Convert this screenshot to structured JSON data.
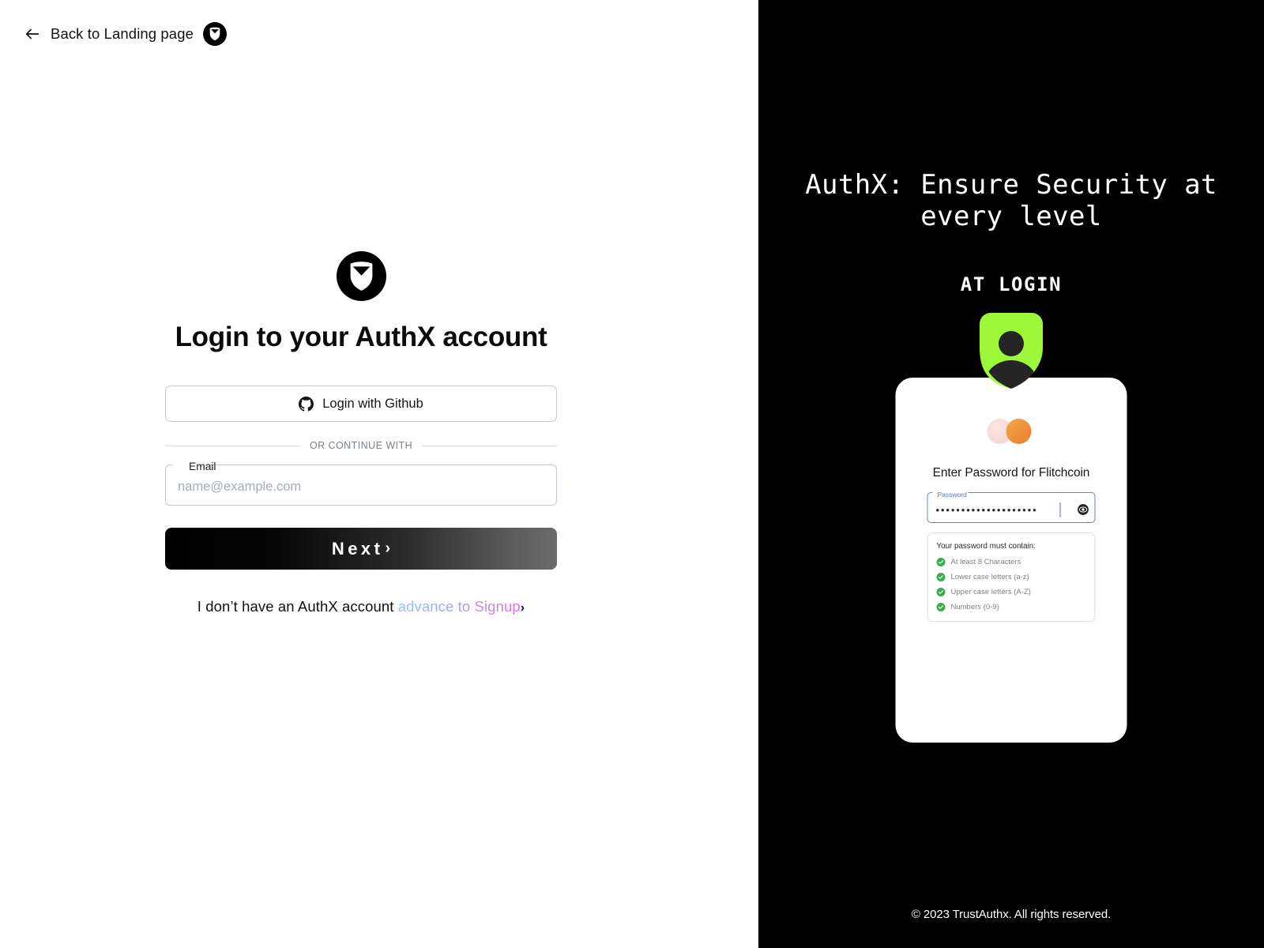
{
  "left": {
    "back_link": {
      "label": "Back to Landing page",
      "arrow_icon": "arrow-left-icon",
      "brand_icon": "authx-shield-badge-icon"
    },
    "logo_icon": "authx-shield-logo-icon",
    "title": "Login to your AuthX account",
    "github_button": {
      "label": "Login with Github",
      "icon": "github-icon"
    },
    "divider_text": "OR CONTINUE WITH",
    "email_field": {
      "label": "Email",
      "placeholder": "name@example.com",
      "value": ""
    },
    "next_button": {
      "label": "Next",
      "chevron": "›"
    },
    "signup": {
      "prefix": "I don’t have an AuthX account",
      "link": "advance to Signup",
      "chevron": "›"
    }
  },
  "right": {
    "promo_title": "AuthX: Ensure Security at every level",
    "promo_subtitle": "AT LOGIN",
    "shield_icon": "user-shield-icon",
    "card": {
      "brand_icon": "mastercard-logo-icon",
      "heading": "Enter Password for Flitchcoin",
      "password_field": {
        "label": "Password",
        "masked_value": "••••••••••••••••••••",
        "reveal_icon": "eye-icon"
      },
      "rules": {
        "title": "Your password must contain:",
        "items": [
          {
            "text": "At least 8 Characters",
            "icon": "check-circle-icon",
            "met": true
          },
          {
            "text": "Lower case letters (a-z)",
            "icon": "check-circle-icon",
            "met": true
          },
          {
            "text": "Upper case letters (A-Z)",
            "icon": "check-circle-icon",
            "met": true
          },
          {
            "text": "Numbers (0-9)",
            "icon": "check-circle-icon",
            "met": true
          }
        ]
      }
    },
    "copyright": "© 2023 TrustAuthx. All rights reserved."
  },
  "colors": {
    "panel_bg": "#000000",
    "page_bg": "#ffffff",
    "accent_green": "#9ef83a",
    "shield_figure": "#252525",
    "check_green": "#3aae4a",
    "link_gradient_start": "#8fc9f5",
    "link_gradient_end": "#e76ee0",
    "field_focus_border": "#6b82c4",
    "mastercard_orange": "#ef8f3c",
    "mastercard_pink": "#f7ded8"
  }
}
